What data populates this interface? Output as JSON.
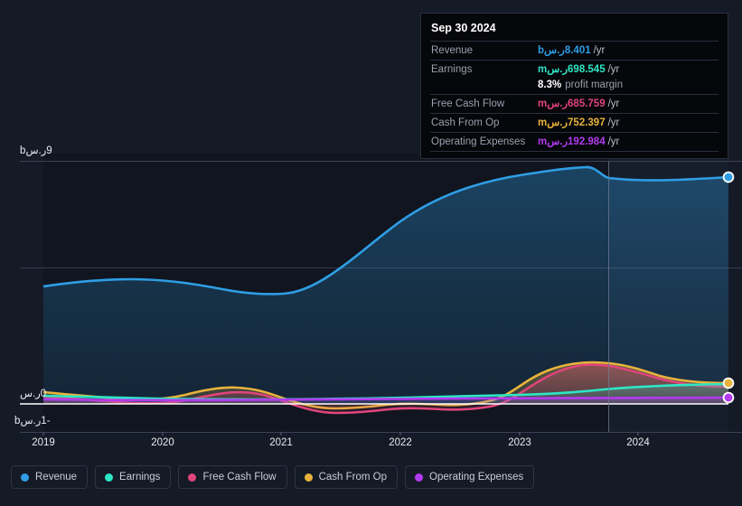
{
  "theme": {
    "background": "#151a27",
    "plot_background": "#0f1420",
    "grid_color": "#3a4052",
    "zero_line_color": "#ffffff",
    "tracker_line_color": "#6f7a93",
    "axis_text_color": "#e8eaf0"
  },
  "tooltip": {
    "date": "Sep 30 2024",
    "rows": [
      {
        "label": "Revenue",
        "value": "8.401ر.سb",
        "unit": "/yr",
        "color": "#2f9ee5"
      },
      {
        "label": "Earnings",
        "value": "698.545ر.سm",
        "unit": "/yr",
        "color": "#2ee6c5"
      },
      {
        "label": "Free Cash Flow",
        "value": "685.759ر.سm",
        "unit": "/yr",
        "color": "#e0457b"
      },
      {
        "label": "Cash From Op",
        "value": "752.397ر.سm",
        "unit": "/yr",
        "color": "#e8b33c"
      },
      {
        "label": "Operating Expenses",
        "value": "192.984ر.سm",
        "unit": "/yr",
        "color": "#b23bf0"
      }
    ],
    "profit_margin_value": "8.3%",
    "profit_margin_label": "profit margin"
  },
  "legend": {
    "items": [
      {
        "label": "Revenue",
        "color": "#2f9ee5"
      },
      {
        "label": "Earnings",
        "color": "#2ee6c5"
      },
      {
        "label": "Free Cash Flow",
        "color": "#e0457b"
      },
      {
        "label": "Cash From Op",
        "color": "#e8b33c"
      },
      {
        "label": "Operating Expenses",
        "color": "#b23bf0"
      }
    ]
  },
  "axes": {
    "y_top_label": "9ر.سb",
    "y_zero_label": "0ر.س",
    "y_negative_label": "-1ر.سb",
    "x_ticks": [
      "2019",
      "2020",
      "2021",
      "2022",
      "2023",
      "2024"
    ]
  },
  "chart_data": {
    "type": "area",
    "title": "",
    "xlabel": "",
    "ylabel": "ر.س (SAR)",
    "ylim": [
      -1,
      9
    ],
    "y_ticks": [
      9,
      0,
      -1
    ],
    "grid": true,
    "legend_position": "bottom",
    "currency": "ر.س",
    "x_tick_labels": [
      "2019",
      "2020",
      "2021",
      "2022",
      "2023",
      "2024"
    ],
    "x_tick_positions": [
      48,
      180,
      311,
      443,
      575,
      706
    ],
    "tracker_x_label": "Sep 30 2024",
    "highlighted_point": {
      "date": "Sep 30 2024",
      "revenue": 8.401,
      "earnings": 0.698545,
      "free_cash_flow": 0.685759,
      "cash_from_op": 0.752397,
      "operating_expenses": 0.192984,
      "profit_margin": "8.3%"
    },
    "x": [
      2019.0,
      2019.25,
      2019.5,
      2019.75,
      2020.0,
      2020.25,
      2020.5,
      2020.75,
      2021.0,
      2021.25,
      2021.5,
      2021.75,
      2022.0,
      2022.25,
      2022.5,
      2022.75,
      2023.0,
      2023.25,
      2023.5,
      2023.75,
      2024.0,
      2024.25,
      2024.5,
      2024.75
    ],
    "series": [
      {
        "name": "Revenue",
        "color": "#2f9ee5",
        "values": [
          4.38,
          4.46,
          4.54,
          4.59,
          4.58,
          4.48,
          4.35,
          4.25,
          4.18,
          4.16,
          4.22,
          4.4,
          4.72,
          5.12,
          5.55,
          5.98,
          6.38,
          6.82,
          7.22,
          7.45,
          7.58,
          7.76,
          8.05,
          8.4
        ]
      },
      {
        "name": "Earnings",
        "color": "#2ee6c5",
        "values": [
          0.3,
          0.29,
          0.28,
          0.27,
          0.26,
          0.25,
          0.24,
          0.23,
          0.22,
          0.24,
          0.26,
          0.28,
          0.3,
          0.33,
          0.35,
          0.37,
          0.4,
          0.45,
          0.52,
          0.58,
          0.62,
          0.65,
          0.68,
          0.7
        ]
      },
      {
        "name": "Free Cash Flow",
        "color": "#e0457b",
        "values": [
          0.22,
          0.16,
          0.08,
          0.0,
          -0.06,
          -0.02,
          0.18,
          0.42,
          0.5,
          0.36,
          0.1,
          -0.14,
          -0.3,
          -0.34,
          -0.3,
          -0.18,
          0.12,
          0.7,
          1.18,
          1.42,
          1.36,
          1.08,
          0.82,
          0.69
        ]
      },
      {
        "name": "Cash From Op",
        "color": "#e8b33c",
        "values": [
          0.4,
          0.34,
          0.26,
          0.18,
          0.12,
          0.16,
          0.36,
          0.6,
          0.68,
          0.54,
          0.28,
          0.04,
          -0.12,
          -0.18,
          -0.14,
          -0.02,
          0.3,
          0.88,
          1.32,
          1.52,
          1.46,
          1.18,
          0.9,
          0.75
        ]
      },
      {
        "name": "Operating Expenses",
        "color": "#b23bf0",
        "values": [
          0.16,
          0.16,
          0.16,
          0.16,
          0.17,
          0.17,
          0.17,
          0.17,
          0.17,
          0.17,
          0.17,
          0.17,
          0.17,
          0.17,
          0.17,
          0.17,
          0.18,
          0.18,
          0.18,
          0.19,
          0.19,
          0.19,
          0.19,
          0.19
        ]
      }
    ]
  }
}
